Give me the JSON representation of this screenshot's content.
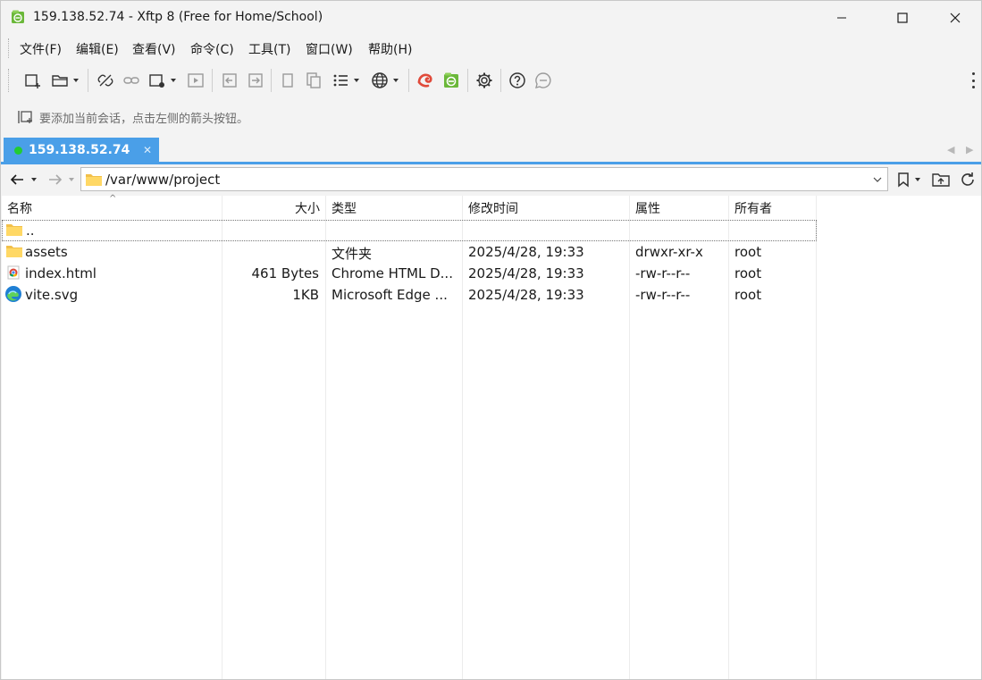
{
  "window": {
    "title": "159.138.52.74 - Xftp 8 (Free for Home/School)",
    "app_icon": "xftp-icon"
  },
  "menu": [
    {
      "label": "文件(F)"
    },
    {
      "label": "编辑(E)"
    },
    {
      "label": "查看(V)"
    },
    {
      "label": "命令(C)"
    },
    {
      "label": "工具(T)"
    },
    {
      "label": "窗口(W)"
    },
    {
      "label": "帮助(H)"
    }
  ],
  "session_hint": "要添加当前会话，点击左侧的箭头按钮。",
  "tab": {
    "label": "159.138.52.74",
    "status_color": "#22cc33",
    "accent": "#4a9fe8"
  },
  "address": {
    "path": "/var/www/project"
  },
  "columns": [
    "名称",
    "大小",
    "类型",
    "修改时间",
    "属性",
    "所有者"
  ],
  "rows": [
    {
      "name": "..",
      "size": "",
      "type": "",
      "modified": "",
      "attrs": "",
      "owner": "",
      "icon": "folder-icon"
    },
    {
      "name": "assets",
      "size": "",
      "type": "文件夹",
      "modified": "2025/4/28, 19:33",
      "attrs": "drwxr-xr-x",
      "owner": "root",
      "icon": "folder-icon"
    },
    {
      "name": "index.html",
      "size": "461 Bytes",
      "type": "Chrome HTML D...",
      "modified": "2025/4/28, 19:33",
      "attrs": "-rw-r--r--",
      "owner": "root",
      "icon": "chrome-icon"
    },
    {
      "name": "vite.svg",
      "size": "1KB",
      "type": "Microsoft Edge ...",
      "modified": "2025/4/28, 19:33",
      "attrs": "-rw-r--r--",
      "owner": "root",
      "icon": "edge-icon"
    }
  ]
}
